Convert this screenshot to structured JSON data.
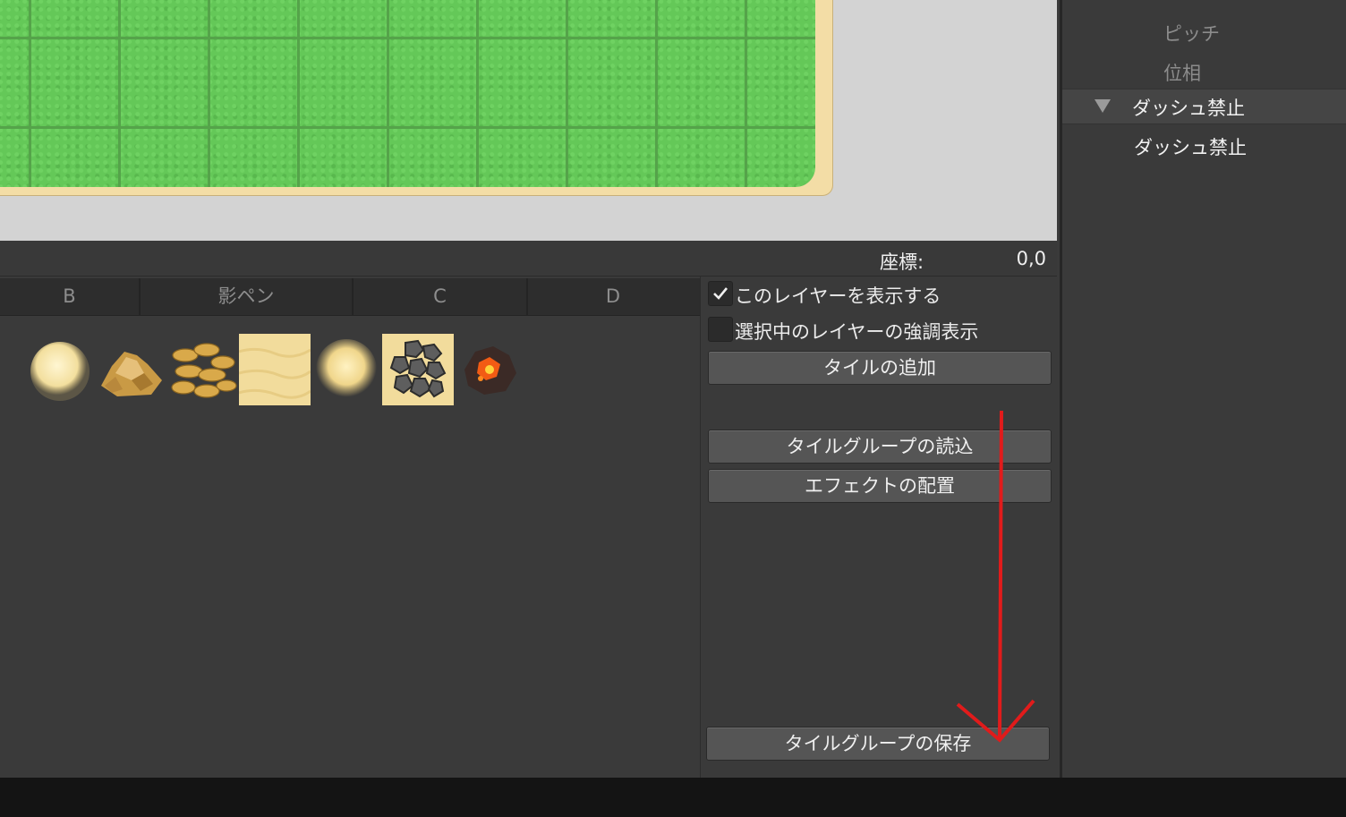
{
  "coords": {
    "label": "座標:",
    "value": "0,0"
  },
  "tabs": [
    {
      "label": "B"
    },
    {
      "label": "影ペン"
    },
    {
      "label": "C"
    },
    {
      "label": "D"
    }
  ],
  "tiles": [
    {
      "icon": "sand-ball-icon"
    },
    {
      "icon": "rock-pile-icon"
    },
    {
      "icon": "gold-coins-icon"
    },
    {
      "icon": "sand-floor-icon"
    },
    {
      "icon": "sand-dot-icon"
    },
    {
      "icon": "stone-floor-icon"
    },
    {
      "icon": "lava-rock-icon"
    }
  ],
  "layer_panel": {
    "show_layer": {
      "label": "このレイヤーを表示する",
      "checked": true
    },
    "highlight_layer": {
      "label": "選択中のレイヤーの強調表示",
      "checked": false
    },
    "add_tile_label": "タイルの追加",
    "load_group_label": "タイルグループの読込",
    "place_effect_label": "エフェクトの配置",
    "save_group_label": "タイルグループの保存"
  },
  "properties": {
    "dim_items": [
      "ピッチ",
      "位相"
    ],
    "section_title": "ダッシュ禁止",
    "section_item": "ダッシュ禁止"
  },
  "colors": {
    "annotation_arrow": "#e11b1b",
    "grass": "#64c858",
    "sand": "#f3dda6"
  }
}
